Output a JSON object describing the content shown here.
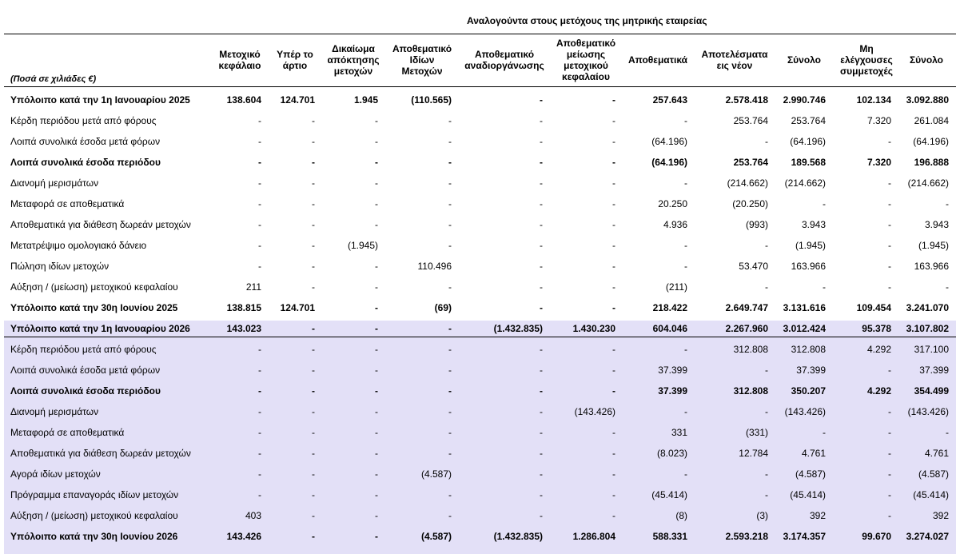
{
  "super_header": "Αναλογούντα στους μετόχους της μητρικής εταιρείας",
  "unit_label": "(Ποσά σε χιλιάδες €)",
  "columns": [
    "Μετοχικό\nκεφάλαιο",
    "Υπέρ το\nάρτιο",
    "Δικαίωμα\nαπόκτησης\nμετοχών",
    "Αποθεματικό\nΙδίων\nΜετοχών",
    "Αποθεματικό\nαναδιοργάνωσης",
    "Αποθεματικό\nμείωσης\nμετοχικού\nκεφαλαίου",
    "Αποθεματικά",
    "Αποτελέσματα\nεις νέον",
    "Σύνολο",
    "Μη\nελέγχουσες\nσυμμετοχές",
    "Σύνολο"
  ],
  "rows": [
    {
      "label": "Υπόλοιπο κατά την 1η Ιανουαρίου 2025",
      "bold": true,
      "values": [
        "138.604",
        "124.701",
        "1.945",
        "(110.565)",
        "-",
        "-",
        "257.643",
        "2.578.418",
        "2.990.746",
        "102.134",
        "3.092.880"
      ]
    },
    {
      "label": "Κέρδη περιόδου μετά από φόρους",
      "bold": false,
      "values": [
        "-",
        "-",
        "-",
        "-",
        "-",
        "-",
        "-",
        "253.764",
        "253.764",
        "7.320",
        "261.084"
      ]
    },
    {
      "label": "Λοιπά συνολικά έσοδα μετά φόρων",
      "bold": false,
      "values": [
        "-",
        "-",
        "-",
        "-",
        "-",
        "-",
        "(64.196)",
        "-",
        "(64.196)",
        "-",
        "(64.196)"
      ]
    },
    {
      "label": "Λοιπά συνολικά έσοδα περιόδου",
      "bold": true,
      "values": [
        "-",
        "-",
        "-",
        "-",
        "-",
        "-",
        "(64.196)",
        "253.764",
        "189.568",
        "7.320",
        "196.888"
      ]
    },
    {
      "label": "Διανομή μερισμάτων",
      "bold": false,
      "values": [
        "-",
        "-",
        "-",
        "-",
        "-",
        "-",
        "-",
        "(214.662)",
        "(214.662)",
        "-",
        "(214.662)"
      ]
    },
    {
      "label": "Μεταφορά σε αποθεματικά",
      "bold": false,
      "values": [
        "-",
        "-",
        "-",
        "-",
        "-",
        "-",
        "20.250",
        "(20.250)",
        "-",
        "-",
        "-"
      ]
    },
    {
      "label": "Αποθεματικά για διάθεση δωρεάν μετοχών",
      "bold": false,
      "values": [
        "-",
        "-",
        "-",
        "-",
        "-",
        "-",
        "4.936",
        "(993)",
        "3.943",
        "-",
        "3.943"
      ]
    },
    {
      "label": "Μετατρέψιμο ομολογιακό δάνειο",
      "bold": false,
      "values": [
        "-",
        "-",
        "(1.945)",
        "-",
        "-",
        "-",
        "-",
        "-",
        "(1.945)",
        "-",
        "(1.945)"
      ]
    },
    {
      "label": "Πώληση ιδίων μετοχών",
      "bold": false,
      "values": [
        "-",
        "-",
        "-",
        "110.496",
        "-",
        "-",
        "-",
        "53.470",
        "163.966",
        "-",
        "163.966"
      ]
    },
    {
      "label": "Αύξηση / (μείωση) μετοχικού κεφαλαίου",
      "bold": false,
      "values": [
        "211",
        "-",
        "-",
        "-",
        "-",
        "-",
        "(211)",
        "-",
        "-",
        "-",
        "-"
      ]
    },
    {
      "label": "Υπόλοιπο κατά την 30η Ιουνίου 2025",
      "bold": true,
      "values": [
        "138.815",
        "124.701",
        "-",
        "(69)",
        "-",
        "-",
        "218.422",
        "2.649.747",
        "3.131.616",
        "109.454",
        "3.241.070"
      ]
    },
    {
      "label": "Υπόλοιπο κατά την 1η Ιανουαρίου 2026",
      "bold": true,
      "values": [
        "143.023",
        "-",
        "-",
        "-",
        "(1.432.835)",
        "1.430.230",
        "604.046",
        "2.267.960",
        "3.012.424",
        "95.378",
        "3.107.802"
      ]
    },
    {
      "label": "Κέρδη περιόδου μετά από φόρους",
      "bold": false,
      "values": [
        "-",
        "-",
        "-",
        "-",
        "-",
        "-",
        "-",
        "312.808",
        "312.808",
        "4.292",
        "317.100"
      ]
    },
    {
      "label": "Λοιπά συνολικά έσοδα μετά φόρων",
      "bold": false,
      "values": [
        "-",
        "-",
        "-",
        "-",
        "-",
        "-",
        "37.399",
        "-",
        "37.399",
        "-",
        "37.399"
      ]
    },
    {
      "label": "Λοιπά συνολικά έσοδα περιόδου",
      "bold": true,
      "values": [
        "-",
        "-",
        "-",
        "-",
        "-",
        "-",
        "37.399",
        "312.808",
        "350.207",
        "4.292",
        "354.499"
      ]
    },
    {
      "label": "Διανομή μερισμάτων",
      "bold": false,
      "values": [
        "-",
        "-",
        "-",
        "-",
        "-",
        "(143.426)",
        "-",
        "-",
        "(143.426)",
        "-",
        "(143.426)"
      ]
    },
    {
      "label": "Μεταφορά σε αποθεματικά",
      "bold": false,
      "values": [
        "-",
        "-",
        "-",
        "-",
        "-",
        "-",
        "331",
        "(331)",
        "-",
        "-",
        "-"
      ]
    },
    {
      "label": "Αποθεματικά για διάθεση δωρεάν μετοχών",
      "bold": false,
      "values": [
        "-",
        "-",
        "-",
        "-",
        "-",
        "-",
        "(8.023)",
        "12.784",
        "4.761",
        "-",
        "4.761"
      ]
    },
    {
      "label": "Αγορά ιδίων μετοχών",
      "bold": false,
      "values": [
        "-",
        "-",
        "-",
        "(4.587)",
        "-",
        "-",
        "-",
        "-",
        "(4.587)",
        "-",
        "(4.587)"
      ]
    },
    {
      "label": "Πρόγραμμα επαναγοράς ιδίων μετοχών",
      "bold": false,
      "values": [
        "-",
        "-",
        "-",
        "-",
        "-",
        "-",
        "(45.414)",
        "-",
        "(45.414)",
        "-",
        "(45.414)"
      ]
    },
    {
      "label": "Αύξηση / (μείωση) μετοχικού κεφαλαίου",
      "bold": false,
      "values": [
        "403",
        "-",
        "-",
        "-",
        "-",
        "-",
        "(8)",
        "(3)",
        "392",
        "-",
        "392"
      ]
    },
    {
      "label": "Υπόλοιπο κατά την 30η Ιουνίου 2026",
      "bold": true,
      "values": [
        "143.426",
        "-",
        "-",
        "(4.587)",
        "(1.432.835)",
        "1.286.804",
        "588.331",
        "2.593.218",
        "3.174.357",
        "99.670",
        "3.274.027"
      ]
    }
  ]
}
